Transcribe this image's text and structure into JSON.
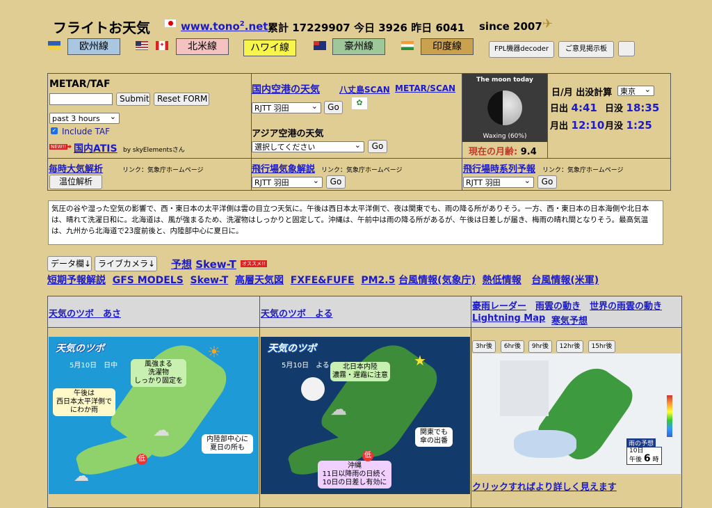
{
  "header": {
    "site_title": "フライトお天気",
    "site_url_pre": "www.tono",
    "site_url_sup": "2",
    "site_url_post": ".net",
    "counter_label_total": "累計",
    "counter_total": "17229907",
    "counter_label_today": "今日",
    "counter_today": "3926",
    "counter_label_yesterday": "昨日",
    "counter_yesterday": "6041",
    "since": "since 2007"
  },
  "region_buttons": [
    {
      "label": "欧州線",
      "color": "#a9c7e0"
    },
    {
      "label": "北米線",
      "color": "#f5c2c2"
    },
    {
      "label": "ハワイ線",
      "color": "#f7f54a"
    },
    {
      "label": "豪州線",
      "color": "#9ec79a"
    },
    {
      "label": "印度線",
      "color": "#c9a14f"
    }
  ],
  "tool_buttons": {
    "fpl": "FPL機器decoder",
    "board": "ご意見掲示板"
  },
  "metar_panel": {
    "title": "METAR/TAF",
    "submit": "Submit",
    "reset": "Reset FORM",
    "period": "past 3 hours",
    "include_taf": "Include TAF",
    "new_badge": "NEW!!",
    "atis_link": "国内ATIS",
    "atis_credit": "by skyElementsさん"
  },
  "domestic_panel": {
    "title": "国内空港の天気",
    "scan_link": "八丈島SCAN",
    "metar_scan_link": "METAR/SCAN",
    "airport": "RJTT 羽田",
    "go": "Go",
    "asia_title": "アジア空港の天気",
    "asia_select": "選択してください"
  },
  "moon_panel": {
    "title": "The moon today",
    "phase": "Waxing (60%)",
    "age_label": "現在の月齢:",
    "age_value": "9.4"
  },
  "sun_panel": {
    "title": "日/月 出没計算",
    "city": "東京",
    "sunrise_label": "日出",
    "sunrise": "4:41",
    "sunset_label": "日没",
    "sunset": "18:35",
    "moonrise_label": "月出",
    "moonrise": "12:10",
    "moonset_label": "月没",
    "moonset": "1:25"
  },
  "row2": {
    "hourly_link": "毎時大気解析",
    "hourly_note": "リンク：気象庁ホームページ",
    "temp_button": "温位解析",
    "aero_link": "飛行場気象解説",
    "aero_note": "リンク：気象庁ホームページ",
    "aero_airport": "RJTT 羽田",
    "series_link": "飛行場時系列予報",
    "series_note": "リンク：気象庁ホームページ",
    "series_airport": "RJTT 羽田",
    "go": "Go"
  },
  "summary": "気圧の谷や湿った空気の影響で、西・東日本の太平洋側は雲の目立つ天気に。午後は西日本太平洋側で、夜は関東でも、雨の降る所がありそう。一方、西・東日本の日本海側や北日本は、晴れて洗濯日和に。北海道は、風が強まるため、洗濯物はしっかりと固定して。沖縄は、午前中は雨の降る所があるが、午後は日差しが届き、梅雨の晴れ間となりそう。最高気温は、九州から北海道で23度前後と、内陸部中心に夏日に。",
  "nav": {
    "data_btn": "データ欄↓",
    "live_btn": "ライブカメラ↓",
    "forecast_label": "予想",
    "skewt_main": "Skew-T",
    "recommend": "オススメ!!",
    "links": [
      "短期予報解説",
      "GFS MODELS",
      "Skew-T",
      "高層天気図",
      "FXFE&FUFE",
      "PM2.5",
      "台風情報(気象庁)",
      "熱低情報",
      "台風情報(米軍)"
    ]
  },
  "cards": {
    "morning_title": "天気のツボ　あさ",
    "night_title": "天気のツボ　よる",
    "radar_links": [
      "豪雨レーダー",
      "雨雲の動き",
      "世界の雨雲の動き",
      "Lightning Map",
      "寒気予想"
    ],
    "hour_buttons": [
      "3hr後",
      "6hr後",
      "9hr後",
      "12hr後",
      "15hr後"
    ],
    "click_text": "クリックすればより詳しく見えます"
  },
  "morning_map": {
    "brand": "天気のツボ",
    "date": "5月10日　日中",
    "b1": "風強まる\n洗濯物\nしっかり固定を",
    "b2": "午後は\n西日本太平洋側で\nにわか雨",
    "b3": "内陸部中心に\n夏日の所も",
    "low": "低"
  },
  "night_map": {
    "brand": "天気のツボ",
    "date": "5月10日　よる",
    "b1": "北日本内陸\n濃霧・遅霜に注意",
    "b2": "関東でも\n傘の出番",
    "b3": "沖縄\n11日以降雨の日続く\n10日の日差し有効に",
    "low": "低"
  },
  "radar_map": {
    "label": "雨の予想",
    "date": "10日",
    "ampm": "午後",
    "hour": "6",
    "unit": "時"
  }
}
